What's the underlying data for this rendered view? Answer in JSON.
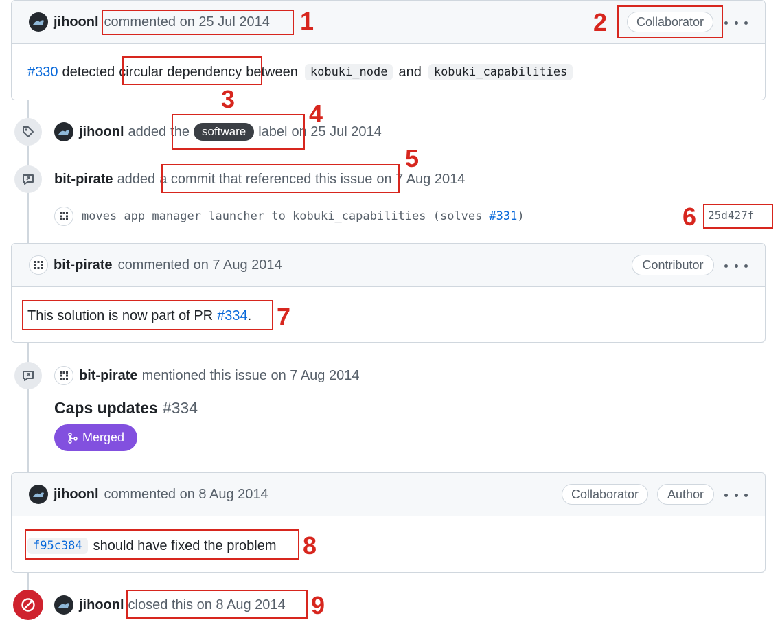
{
  "comment1": {
    "author": "jihoonl",
    "meta": "commented on 25 Jul 2014",
    "badge": "Collaborator",
    "body": {
      "issue_link": "#330",
      "text1": "detected",
      "highlight": "circular dependency",
      "text2": "between",
      "code1": "kobuki_node",
      "text3": "and",
      "code2": "kobuki_capabilities"
    }
  },
  "event_label": {
    "author": "jihoonl",
    "text1": "added",
    "text2": "the",
    "label": "software",
    "text3": "label",
    "date": "on 25 Jul 2014"
  },
  "event_commit": {
    "author": "bit-pirate",
    "text1": "added",
    "link_text": "a commit that referenced this issue",
    "date": "on 7 Aug 2014",
    "commit_message": "moves app manager launcher to kobuki_capabilities (solves",
    "commit_issue": "#331",
    "commit_close": ")",
    "sha": "25d427f"
  },
  "comment2": {
    "author": "bit-pirate",
    "meta": "commented on 7 Aug 2014",
    "badge": "Contributor",
    "body_text": "This solution is now part of PR",
    "body_link": "#334",
    "body_end": "."
  },
  "event_mention": {
    "author": "bit-pirate",
    "text": "mentioned this issue on 7 Aug 2014",
    "pr_title": "Caps updates",
    "pr_number": "#334",
    "pr_state": "Merged"
  },
  "comment3": {
    "author": "jihoonl",
    "meta": "commented on 8 Aug 2014",
    "badge1": "Collaborator",
    "badge2": "Author",
    "sha": "f95c384",
    "body_text": "should have fixed the problem"
  },
  "event_closed": {
    "author": "jihoonl",
    "text": "closed this on 8 Aug 2014"
  },
  "annotations": [
    "1",
    "2",
    "3",
    "4",
    "5",
    "6",
    "7",
    "8",
    "9"
  ],
  "colors": {
    "annotation": "#d7261e",
    "link": "#0969da",
    "merged": "#8250df",
    "closed": "#cf222e"
  }
}
